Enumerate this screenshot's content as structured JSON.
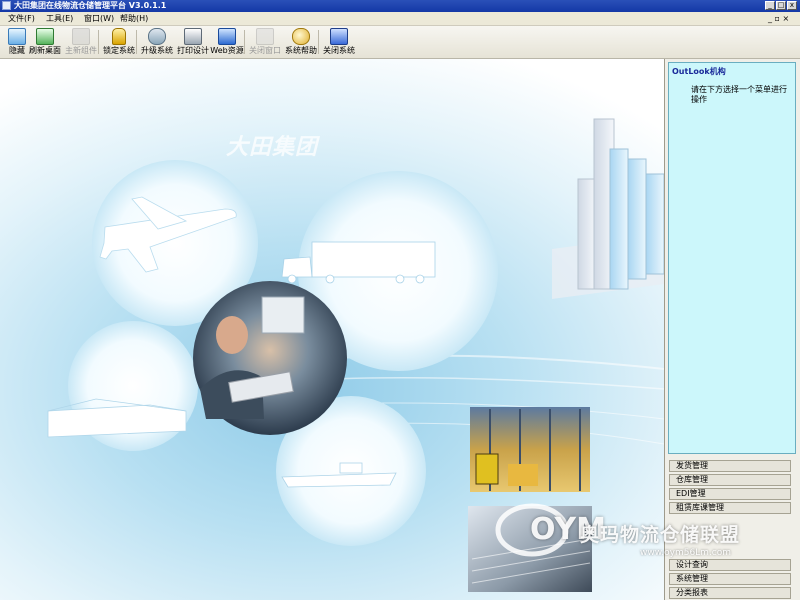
{
  "window": {
    "title": "大田集团在线物流仓储管理平台  V3.0.1.1",
    "controls": {
      "minimize": "_",
      "maximize": "□",
      "close": "x"
    }
  },
  "menu": {
    "items": [
      {
        "label": "文件(F)"
      },
      {
        "label": "工具(E)"
      },
      {
        "label": "窗口(W)"
      },
      {
        "label": "帮助(H)"
      }
    ],
    "right_controls": "_ ▫ ×"
  },
  "toolbar": {
    "items": [
      {
        "label": "隐藏",
        "icon": "hide-icon",
        "color": "#2e8b57",
        "enabled": true
      },
      {
        "label": "刷新桌面",
        "icon": "refresh-desktop-icon",
        "color": "#3aa04a",
        "enabled": true
      },
      {
        "label": "主新组件",
        "icon": "component-icon",
        "color": "#9a9a9a",
        "enabled": false
      },
      {
        "label": "锁定系统",
        "icon": "lock-icon",
        "color": "#d9a400",
        "enabled": true
      },
      {
        "label": "升级系统",
        "icon": "upgrade-icon",
        "color": "#4a8a3a",
        "enabled": true
      },
      {
        "label": "打印设计",
        "icon": "printer-icon",
        "color": "#6b7b8c",
        "enabled": true
      },
      {
        "label": "Web资源",
        "icon": "web-resource-icon",
        "color": "#2d6bd1",
        "enabled": true
      },
      {
        "label": "关闭窗口",
        "icon": "close-window-icon",
        "color": "#9a9a9a",
        "enabled": false
      },
      {
        "label": "系统帮助",
        "icon": "help-icon",
        "color": "#e0b030",
        "enabled": true
      },
      {
        "label": "关闭系统",
        "icon": "shutdown-icon",
        "color": "#c83232",
        "enabled": true
      }
    ]
  },
  "banner": {
    "logo_text": "大田集团"
  },
  "outlook": {
    "title": "OutLook机构",
    "hint": "请在下方选择一个菜单进行操作",
    "nav": [
      {
        "label": "发货管理"
      },
      {
        "label": "仓库管理"
      },
      {
        "label": "EDI管理"
      },
      {
        "label": "租赁库课管理"
      },
      {
        "label": "设计查询"
      },
      {
        "label": "系统管理"
      },
      {
        "label": "分类报表"
      }
    ]
  },
  "watermark": {
    "logo": "OYM",
    "name": "奥玛物流仓储联盟",
    "url": "www.oym56Lm.com"
  },
  "colors": {
    "titlebar": "#1438a6",
    "outlook_bg": "#ccf7fb",
    "canvas_accent": "#8fcbe8"
  }
}
